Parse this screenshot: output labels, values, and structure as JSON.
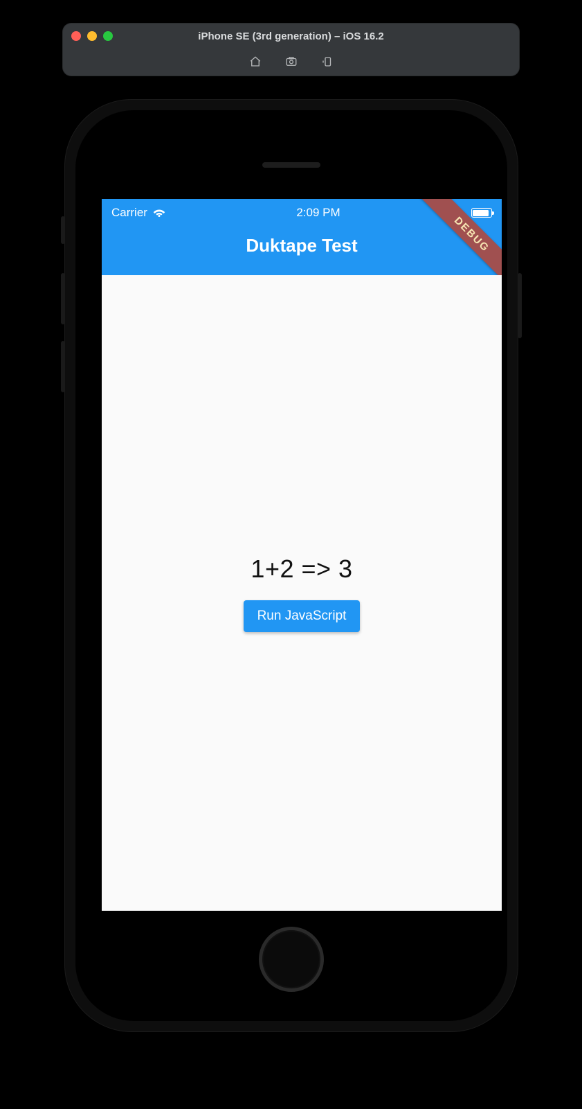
{
  "simulator": {
    "title": "iPhone SE (3rd generation) – iOS 16.2",
    "icons": {
      "home": "home-icon",
      "screenshot": "screenshot-icon",
      "rotate": "rotate-icon"
    }
  },
  "status_bar": {
    "carrier": "Carrier",
    "time": "2:09 PM"
  },
  "app": {
    "title": "Duktape Test",
    "debug_banner": "DEBUG",
    "result_text": "1+2 => 3",
    "run_button_label": "Run JavaScript"
  },
  "colors": {
    "primary": "#2196f3",
    "banner": "#a05050"
  }
}
